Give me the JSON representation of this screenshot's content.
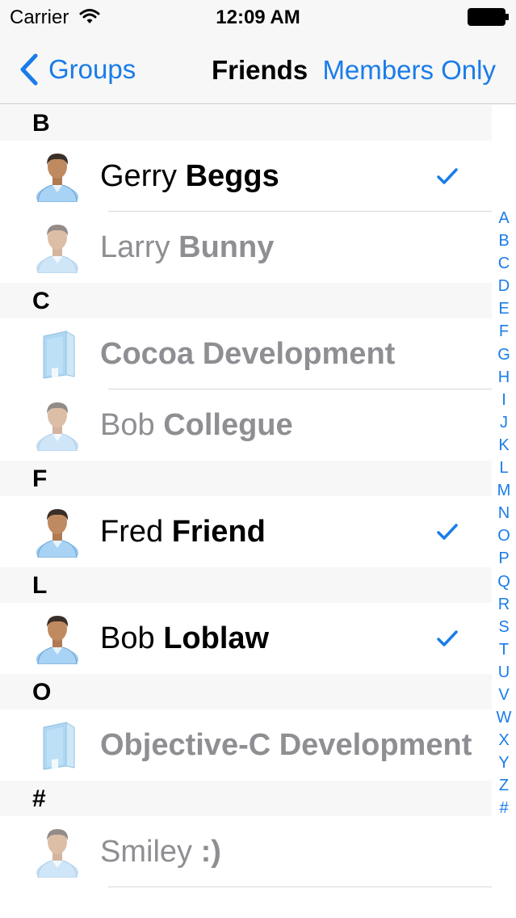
{
  "status_bar": {
    "carrier": "Carrier",
    "time": "12:09 AM"
  },
  "nav": {
    "back_label": "Groups",
    "title": "Friends",
    "right_button": "Members Only"
  },
  "accent_color": "#1a7ce8",
  "sections": [
    {
      "header": "B",
      "rows": [
        {
          "first": "Gerry",
          "last": "Beggs",
          "type": "person",
          "selected": true,
          "dimmed": false
        },
        {
          "first": "Larry",
          "last": "Bunny",
          "type": "person",
          "selected": false,
          "dimmed": true
        }
      ]
    },
    {
      "header": "C",
      "rows": [
        {
          "first": "",
          "last": "Cocoa Development",
          "type": "company",
          "selected": false,
          "dimmed": true
        },
        {
          "first": "Bob",
          "last": "Collegue",
          "type": "person",
          "selected": false,
          "dimmed": true
        }
      ]
    },
    {
      "header": "F",
      "rows": [
        {
          "first": "Fred",
          "last": "Friend",
          "type": "person",
          "selected": true,
          "dimmed": false
        }
      ]
    },
    {
      "header": "L",
      "rows": [
        {
          "first": "Bob",
          "last": "Loblaw",
          "type": "person",
          "selected": true,
          "dimmed": false
        }
      ]
    },
    {
      "header": "O",
      "rows": [
        {
          "first": "",
          "last": "Objective-C Development",
          "type": "company",
          "selected": false,
          "dimmed": true
        }
      ]
    },
    {
      "header": "#",
      "rows": [
        {
          "first": "Smiley",
          "last": ":)",
          "type": "person",
          "selected": false,
          "dimmed": true
        }
      ]
    }
  ],
  "index_letters": [
    "A",
    "B",
    "C",
    "D",
    "E",
    "F",
    "G",
    "H",
    "I",
    "J",
    "K",
    "L",
    "M",
    "N",
    "O",
    "P",
    "Q",
    "R",
    "S",
    "T",
    "U",
    "V",
    "W",
    "X",
    "Y",
    "Z",
    "#"
  ]
}
